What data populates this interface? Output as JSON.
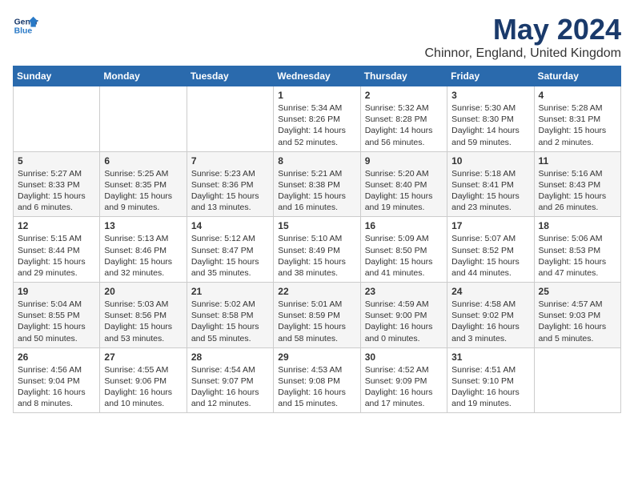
{
  "logo": {
    "line1": "General",
    "line2": "Blue"
  },
  "title": "May 2024",
  "subtitle": "Chinnor, England, United Kingdom",
  "days_of_week": [
    "Sunday",
    "Monday",
    "Tuesday",
    "Wednesday",
    "Thursday",
    "Friday",
    "Saturday"
  ],
  "weeks": [
    [
      {
        "day": "",
        "info": ""
      },
      {
        "day": "",
        "info": ""
      },
      {
        "day": "",
        "info": ""
      },
      {
        "day": "1",
        "info": "Sunrise: 5:34 AM\nSunset: 8:26 PM\nDaylight: 14 hours and 52 minutes."
      },
      {
        "day": "2",
        "info": "Sunrise: 5:32 AM\nSunset: 8:28 PM\nDaylight: 14 hours and 56 minutes."
      },
      {
        "day": "3",
        "info": "Sunrise: 5:30 AM\nSunset: 8:30 PM\nDaylight: 14 hours and 59 minutes."
      },
      {
        "day": "4",
        "info": "Sunrise: 5:28 AM\nSunset: 8:31 PM\nDaylight: 15 hours and 2 minutes."
      }
    ],
    [
      {
        "day": "5",
        "info": "Sunrise: 5:27 AM\nSunset: 8:33 PM\nDaylight: 15 hours and 6 minutes."
      },
      {
        "day": "6",
        "info": "Sunrise: 5:25 AM\nSunset: 8:35 PM\nDaylight: 15 hours and 9 minutes."
      },
      {
        "day": "7",
        "info": "Sunrise: 5:23 AM\nSunset: 8:36 PM\nDaylight: 15 hours and 13 minutes."
      },
      {
        "day": "8",
        "info": "Sunrise: 5:21 AM\nSunset: 8:38 PM\nDaylight: 15 hours and 16 minutes."
      },
      {
        "day": "9",
        "info": "Sunrise: 5:20 AM\nSunset: 8:40 PM\nDaylight: 15 hours and 19 minutes."
      },
      {
        "day": "10",
        "info": "Sunrise: 5:18 AM\nSunset: 8:41 PM\nDaylight: 15 hours and 23 minutes."
      },
      {
        "day": "11",
        "info": "Sunrise: 5:16 AM\nSunset: 8:43 PM\nDaylight: 15 hours and 26 minutes."
      }
    ],
    [
      {
        "day": "12",
        "info": "Sunrise: 5:15 AM\nSunset: 8:44 PM\nDaylight: 15 hours and 29 minutes."
      },
      {
        "day": "13",
        "info": "Sunrise: 5:13 AM\nSunset: 8:46 PM\nDaylight: 15 hours and 32 minutes."
      },
      {
        "day": "14",
        "info": "Sunrise: 5:12 AM\nSunset: 8:47 PM\nDaylight: 15 hours and 35 minutes."
      },
      {
        "day": "15",
        "info": "Sunrise: 5:10 AM\nSunset: 8:49 PM\nDaylight: 15 hours and 38 minutes."
      },
      {
        "day": "16",
        "info": "Sunrise: 5:09 AM\nSunset: 8:50 PM\nDaylight: 15 hours and 41 minutes."
      },
      {
        "day": "17",
        "info": "Sunrise: 5:07 AM\nSunset: 8:52 PM\nDaylight: 15 hours and 44 minutes."
      },
      {
        "day": "18",
        "info": "Sunrise: 5:06 AM\nSunset: 8:53 PM\nDaylight: 15 hours and 47 minutes."
      }
    ],
    [
      {
        "day": "19",
        "info": "Sunrise: 5:04 AM\nSunset: 8:55 PM\nDaylight: 15 hours and 50 minutes."
      },
      {
        "day": "20",
        "info": "Sunrise: 5:03 AM\nSunset: 8:56 PM\nDaylight: 15 hours and 53 minutes."
      },
      {
        "day": "21",
        "info": "Sunrise: 5:02 AM\nSunset: 8:58 PM\nDaylight: 15 hours and 55 minutes."
      },
      {
        "day": "22",
        "info": "Sunrise: 5:01 AM\nSunset: 8:59 PM\nDaylight: 15 hours and 58 minutes."
      },
      {
        "day": "23",
        "info": "Sunrise: 4:59 AM\nSunset: 9:00 PM\nDaylight: 16 hours and 0 minutes."
      },
      {
        "day": "24",
        "info": "Sunrise: 4:58 AM\nSunset: 9:02 PM\nDaylight: 16 hours and 3 minutes."
      },
      {
        "day": "25",
        "info": "Sunrise: 4:57 AM\nSunset: 9:03 PM\nDaylight: 16 hours and 5 minutes."
      }
    ],
    [
      {
        "day": "26",
        "info": "Sunrise: 4:56 AM\nSunset: 9:04 PM\nDaylight: 16 hours and 8 minutes."
      },
      {
        "day": "27",
        "info": "Sunrise: 4:55 AM\nSunset: 9:06 PM\nDaylight: 16 hours and 10 minutes."
      },
      {
        "day": "28",
        "info": "Sunrise: 4:54 AM\nSunset: 9:07 PM\nDaylight: 16 hours and 12 minutes."
      },
      {
        "day": "29",
        "info": "Sunrise: 4:53 AM\nSunset: 9:08 PM\nDaylight: 16 hours and 15 minutes."
      },
      {
        "day": "30",
        "info": "Sunrise: 4:52 AM\nSunset: 9:09 PM\nDaylight: 16 hours and 17 minutes."
      },
      {
        "day": "31",
        "info": "Sunrise: 4:51 AM\nSunset: 9:10 PM\nDaylight: 16 hours and 19 minutes."
      },
      {
        "day": "",
        "info": ""
      }
    ]
  ]
}
